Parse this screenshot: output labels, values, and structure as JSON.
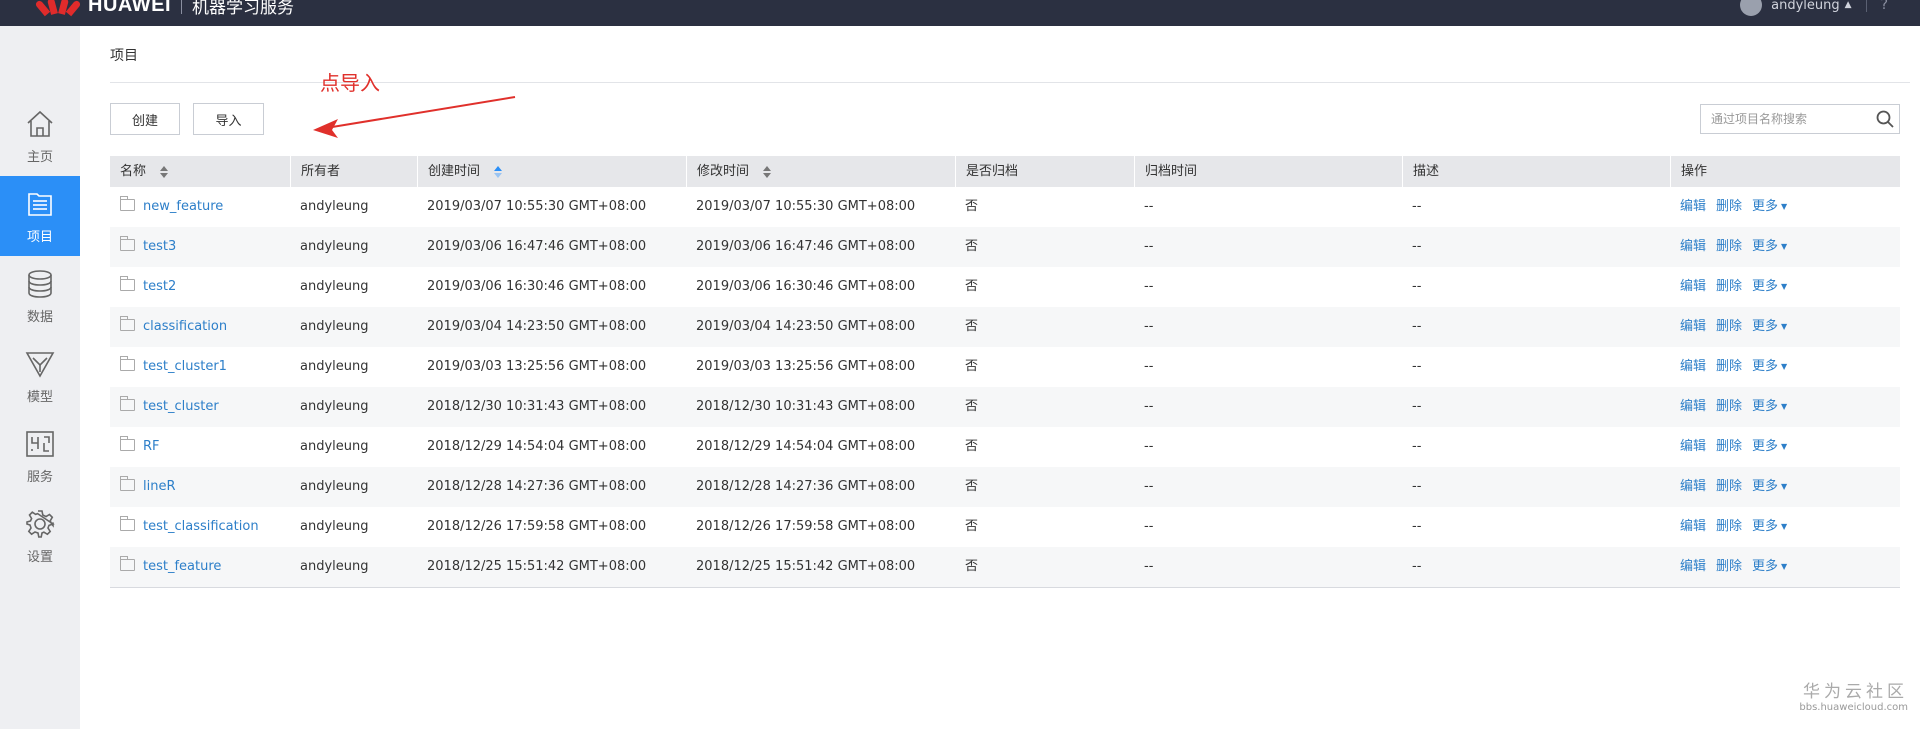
{
  "topbar": {
    "brand": "HUAWEI",
    "product": "机器学习服务",
    "username": "andyleung",
    "help": "?"
  },
  "sidebar": {
    "items": [
      {
        "label": "主页",
        "icon": "home-icon",
        "active": false
      },
      {
        "label": "项目",
        "icon": "project-list-icon",
        "active": true
      },
      {
        "label": "数据",
        "icon": "database-icon",
        "active": false
      },
      {
        "label": "模型",
        "icon": "model-funnel-icon",
        "active": false
      },
      {
        "label": "服务",
        "icon": "service-flow-icon",
        "active": false
      },
      {
        "label": "设置",
        "icon": "gear-icon",
        "active": false
      }
    ]
  },
  "main": {
    "title": "项目",
    "create_label": "创建",
    "import_label": "导入",
    "annotation": "点导入",
    "search_placeholder": "通过项目名称搜索"
  },
  "table": {
    "headers": [
      "名称",
      "所有者",
      "创建时间",
      "修改时间",
      "是否归档",
      "归档时间",
      "描述",
      "操作"
    ],
    "actions": {
      "edit": "编辑",
      "delete": "删除",
      "more": "更多"
    },
    "rows": [
      {
        "name": "new_feature",
        "owner": "andyleung",
        "created": "2019/03/07 10:55:30 GMT+08:00",
        "modified": "2019/03/07 10:55:30 GMT+08:00",
        "archived": "否",
        "archive_time": "--",
        "desc": "--"
      },
      {
        "name": "test3",
        "owner": "andyleung",
        "created": "2019/03/06 16:47:46 GMT+08:00",
        "modified": "2019/03/06 16:47:46 GMT+08:00",
        "archived": "否",
        "archive_time": "--",
        "desc": "--"
      },
      {
        "name": "test2",
        "owner": "andyleung",
        "created": "2019/03/06 16:30:46 GMT+08:00",
        "modified": "2019/03/06 16:30:46 GMT+08:00",
        "archived": "否",
        "archive_time": "--",
        "desc": "--"
      },
      {
        "name": "classification",
        "owner": "andyleung",
        "created": "2019/03/04 14:23:50 GMT+08:00",
        "modified": "2019/03/04 14:23:50 GMT+08:00",
        "archived": "否",
        "archive_time": "--",
        "desc": "--"
      },
      {
        "name": "test_cluster1",
        "owner": "andyleung",
        "created": "2019/03/03 13:25:56 GMT+08:00",
        "modified": "2019/03/03 13:25:56 GMT+08:00",
        "archived": "否",
        "archive_time": "--",
        "desc": "--"
      },
      {
        "name": "test_cluster",
        "owner": "andyleung",
        "created": "2018/12/30 10:31:43 GMT+08:00",
        "modified": "2018/12/30 10:31:43 GMT+08:00",
        "archived": "否",
        "archive_time": "--",
        "desc": "--"
      },
      {
        "name": "RF",
        "owner": "andyleung",
        "created": "2018/12/29 14:54:04 GMT+08:00",
        "modified": "2018/12/29 14:54:04 GMT+08:00",
        "archived": "否",
        "archive_time": "--",
        "desc": "--"
      },
      {
        "name": "lineR",
        "owner": "andyleung",
        "created": "2018/12/28 14:27:36 GMT+08:00",
        "modified": "2018/12/28 14:27:36 GMT+08:00",
        "archived": "否",
        "archive_time": "--",
        "desc": "--"
      },
      {
        "name": "test_classification",
        "owner": "andyleung",
        "created": "2018/12/26 17:59:58 GMT+08:00",
        "modified": "2018/12/26 17:59:58 GMT+08:00",
        "archived": "否",
        "archive_time": "--",
        "desc": "--"
      },
      {
        "name": "test_feature",
        "owner": "andyleung",
        "created": "2018/12/25 15:51:42 GMT+08:00",
        "modified": "2018/12/25 15:51:42 GMT+08:00",
        "archived": "否",
        "archive_time": "--",
        "desc": "--"
      }
    ]
  },
  "watermark": {
    "cn": "华为云社区",
    "url": "bbs.huaweicloud.com"
  },
  "colors": {
    "topbar_bg": "#2b3041",
    "sidebar_bg": "#eeeff2",
    "active_nav": "#2b8ff7",
    "link": "#2d7fc9",
    "annotation": "#e0302b",
    "header_bg": "#e6e7ea"
  }
}
